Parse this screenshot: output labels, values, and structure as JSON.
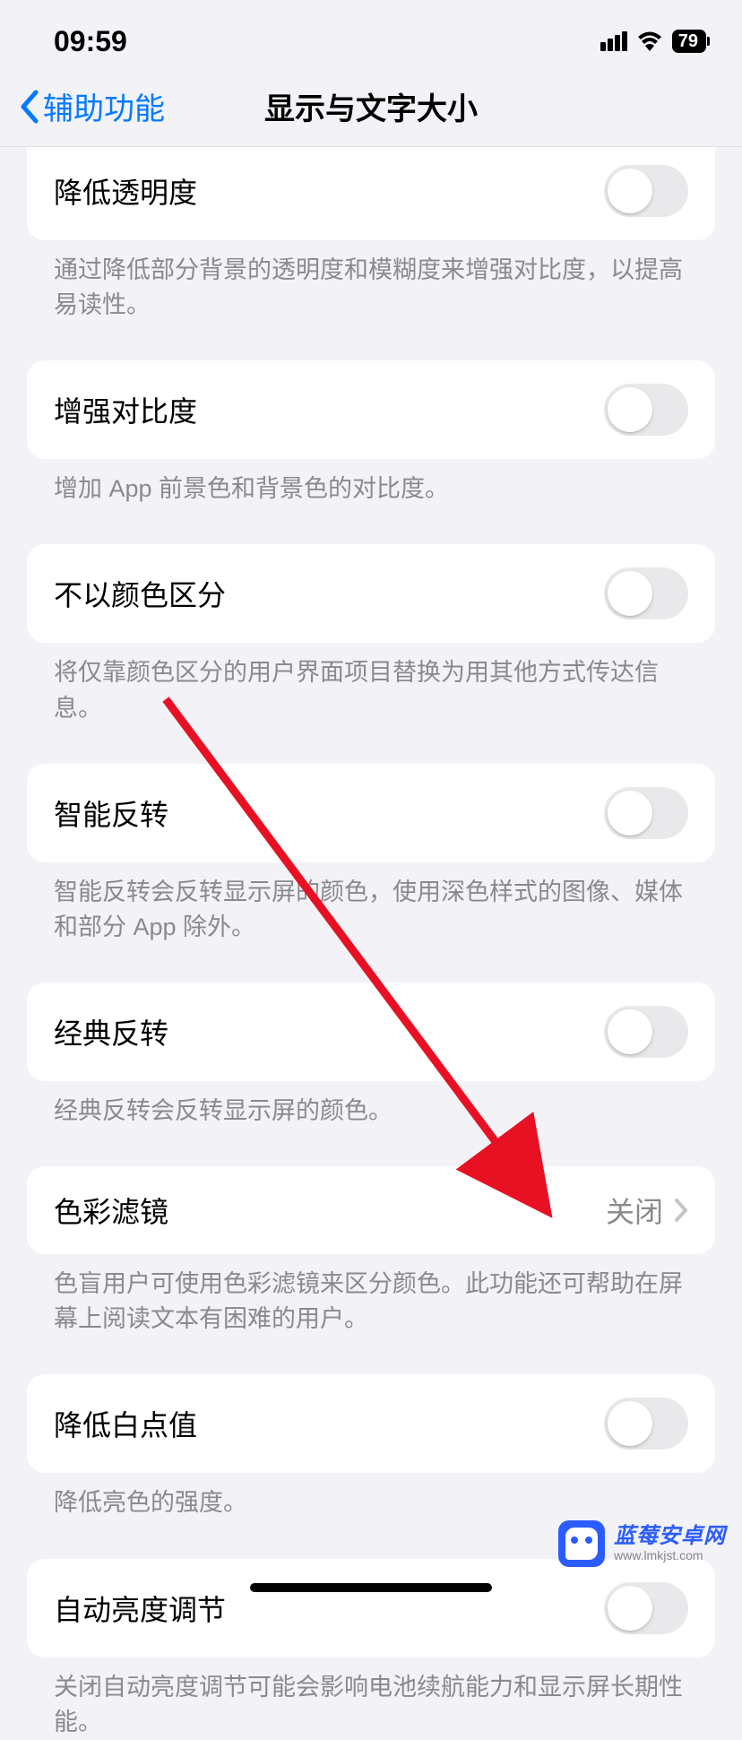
{
  "status": {
    "time": "09:59",
    "battery": "79"
  },
  "nav": {
    "back": "辅助功能",
    "title": "显示与文字大小"
  },
  "rows": {
    "reduce_transparency": {
      "label": "降低透明度",
      "footer": "通过降低部分背景的透明度和模糊度来增强对比度，以提高易读性。"
    },
    "increase_contrast": {
      "label": "增强对比度",
      "footer": "增加 App 前景色和背景色的对比度。"
    },
    "differentiate_without_color": {
      "label": "不以颜色区分",
      "footer": "将仅靠颜色区分的用户界面项目替换为用其他方式传达信息。"
    },
    "smart_invert": {
      "label": "智能反转",
      "footer": "智能反转会反转显示屏的颜色，使用深色样式的图像、媒体和部分 App 除外。"
    },
    "classic_invert": {
      "label": "经典反转",
      "footer": "经典反转会反转显示屏的颜色。"
    },
    "color_filters": {
      "label": "色彩滤镜",
      "value": "关闭",
      "footer": "色盲用户可使用色彩滤镜来区分颜色。此功能还可帮助在屏幕上阅读文本有困难的用户。"
    },
    "reduce_white_point": {
      "label": "降低白点值",
      "footer": "降低亮色的强度。"
    },
    "auto_brightness": {
      "label": "自动亮度调节",
      "footer": "关闭自动亮度调节可能会影响电池续航能力和显示屏长期性能。"
    }
  },
  "watermark": {
    "title": "蓝莓安卓网",
    "url": "www.lmkjst.com"
  }
}
